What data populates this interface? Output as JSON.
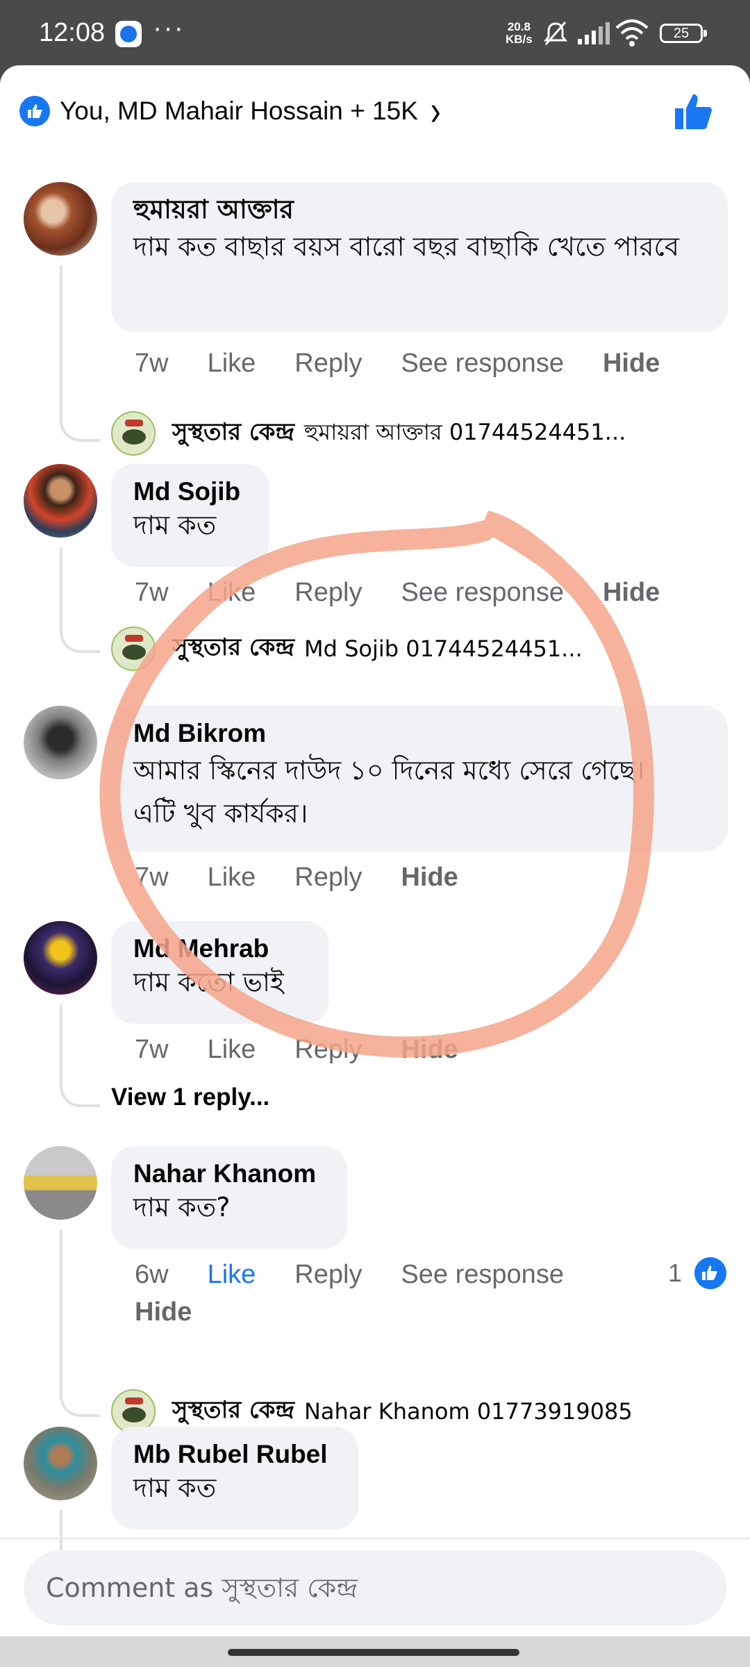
{
  "status_bar": {
    "time": "12:08",
    "dots": "···",
    "speed_value": "20.8",
    "speed_unit": "KB/s",
    "battery": "25"
  },
  "reactions": {
    "summary": "You, MD Mahair Hossain + 15K",
    "accent_color": "#1877f2"
  },
  "comments": [
    {
      "author": "হুমায়রা আক্তার",
      "text": "দাম কত  বাছার বয়স বারো  বছর  বাছাকি খেতে পারবে",
      "time": "7w",
      "like": "Like",
      "reply": "Reply",
      "see_response": "See response",
      "hide": "Hide",
      "page_reply": {
        "name": "সুস্থতার কেন্দ্র",
        "text": "হুমায়রা আক্তার 01744524451..."
      }
    },
    {
      "author": "Md Sojib",
      "text": "দাম কত",
      "time": "7w",
      "like": "Like",
      "reply": "Reply",
      "see_response": "See response",
      "hide": "Hide",
      "page_reply": {
        "name": "সুস্থতার কেন্দ্র",
        "text": "Md Sojib 01744524451..."
      }
    },
    {
      "author": "Md Bikrom",
      "text": "আমার স্কিনের দাউদ ১০ দিনের মধ্যে সেরে গেছে। এটি খুব কার্যকর।",
      "time": "7w",
      "like": "Like",
      "reply": "Reply",
      "hide": "Hide"
    },
    {
      "author": "Md Mehrab",
      "text": "দাম কতো ভাই",
      "time": "7w",
      "like": "Like",
      "reply": "Reply",
      "hide": "Hide",
      "view_replies": "View 1 reply..."
    },
    {
      "author": "Nahar Khanom",
      "text": "দাম কত?",
      "time": "6w",
      "like": "Like",
      "reply": "Reply",
      "see_response": "See response",
      "hide": "Hide",
      "like_count": "1",
      "page_reply": {
        "name": "সুস্থতার কেন্দ্র",
        "text": "Nahar Khanom 01773919085"
      }
    },
    {
      "author": "Mb Rubel Rubel",
      "text": "দাম কত"
    }
  ],
  "composer": {
    "placeholder": "Comment as সুস্থতার কেন্দ্র"
  },
  "colors": {
    "annotation_circle": "#f4a48a",
    "bubble_bg": "#f0f2f5",
    "meta_text": "#65676b"
  }
}
